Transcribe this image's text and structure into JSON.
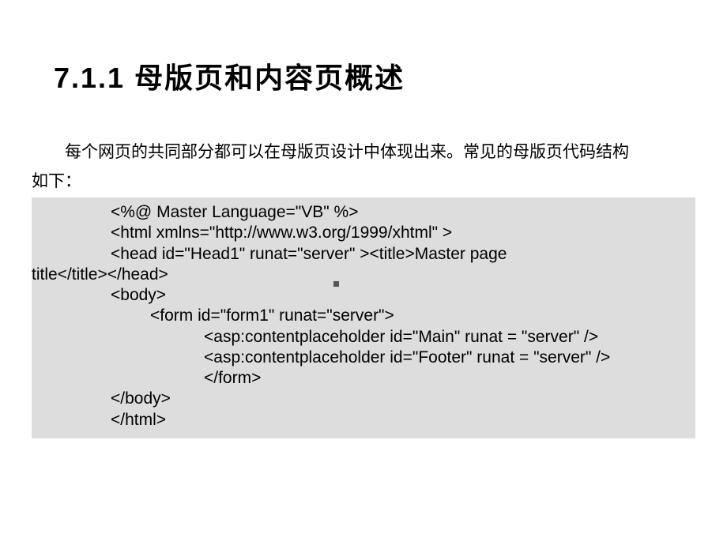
{
  "slide": {
    "title": "7.1.1 母版页和内容页概述",
    "intro_line1": "每个网页的共同部分都可以在母版页设计中体现出来。常见的母版页代码结构",
    "intro_line2": "如下：",
    "code": {
      "line1": "<%@ Master Language=\"VB\" %>",
      "line2": "<html xmlns=\"http://www.w3.org/1999/xhtml\" >",
      "line3a": "<head id=\"Head1\" runat=\"server\" ><title>Master page ",
      "line3b": "title</title></head>",
      "line4": "<body>",
      "line5": "<form id=\"form1\" runat=\"server\">",
      "line6": "<asp:contentplaceholder id=\"Main\" runat = \"server\" />",
      "line7": "<asp:contentplaceholder id=\"Footer\" runat = \"server\" />",
      "line8": "</form>",
      "line9": "</body>",
      "line10": "</html>"
    }
  }
}
